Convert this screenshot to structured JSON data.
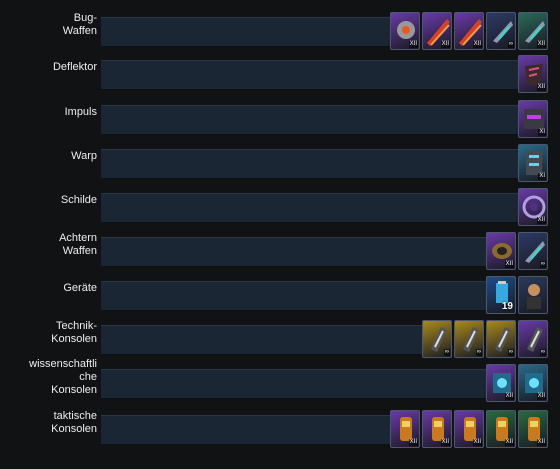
{
  "slots": [
    {
      "label": "Bug-\nWaffen",
      "items": [
        {
          "icon": "torpedo-launcher-icon",
          "badge": "XII",
          "bg": "#6a3aa8"
        },
        {
          "icon": "beam-array-icon",
          "badge": "XII",
          "bg": "#6a3aa8"
        },
        {
          "icon": "beam-array-icon",
          "badge": "XII",
          "bg": "#6a3aa8"
        },
        {
          "icon": "energy-weapon-icon",
          "badge": "∞",
          "bg": "#2d3a66"
        },
        {
          "icon": "energy-weapon-icon",
          "badge": "XII",
          "bg": "#2a6a5a"
        }
      ]
    },
    {
      "label": "Deflektor",
      "items": [
        {
          "icon": "deflector-icon",
          "badge": "XII",
          "bg": "#6a3aa8"
        }
      ]
    },
    {
      "label": "Impuls",
      "items": [
        {
          "icon": "impulse-engine-icon",
          "badge": "XI",
          "bg": "#6a3aa8"
        }
      ]
    },
    {
      "label": "Warp",
      "items": [
        {
          "icon": "warp-core-icon",
          "badge": "XI",
          "bg": "#2a6a88"
        }
      ]
    },
    {
      "label": "Schilde",
      "items": [
        {
          "icon": "shield-icon",
          "badge": "XII",
          "bg": "#6a3aa8"
        }
      ]
    },
    {
      "label": "Achtern\nWaffen",
      "items": [
        {
          "icon": "mine-launcher-icon",
          "badge": "XII",
          "bg": "#6a3aa8"
        },
        {
          "icon": "energy-weapon-icon",
          "badge": "∞",
          "bg": "#2d3a66"
        }
      ]
    },
    {
      "label": "Geräte",
      "items": [
        {
          "icon": "battery-device-icon",
          "badge": "19",
          "bg": "#1e4c88"
        },
        {
          "icon": "crew-device-icon",
          "badge": "",
          "bg": "#2a3a5a"
        }
      ]
    },
    {
      "label": "Technik-\nKonsolen",
      "items": [
        {
          "icon": "engineering-console-icon",
          "badge": "∞",
          "bg": "#a88a20"
        },
        {
          "icon": "engineering-console-icon",
          "badge": "∞",
          "bg": "#a88a20"
        },
        {
          "icon": "engineering-console-icon",
          "badge": "∞",
          "bg": "#a88a20"
        },
        {
          "icon": "engineering-console-icon",
          "badge": "∞",
          "bg": "#6a3aa8"
        }
      ]
    },
    {
      "label": "wissenschaftli\nche\nKonsolen",
      "items": [
        {
          "icon": "science-console-icon",
          "badge": "XII",
          "bg": "#6a3aa8"
        },
        {
          "icon": "science-console-icon",
          "badge": "XII",
          "bg": "#2a6a88"
        }
      ]
    },
    {
      "label": "taktische\nKonsolen",
      "items": [
        {
          "icon": "tactical-console-icon",
          "badge": "XII",
          "bg": "#6a3aa8"
        },
        {
          "icon": "tactical-console-icon",
          "badge": "XII",
          "bg": "#6a3aa8"
        },
        {
          "icon": "tactical-console-icon",
          "badge": "XII",
          "bg": "#6a3aa8"
        },
        {
          "icon": "tactical-console-icon",
          "badge": "XII",
          "bg": "#2a6a40"
        },
        {
          "icon": "tactical-console-icon",
          "badge": "XII",
          "bg": "#2a6a40"
        }
      ]
    }
  ]
}
